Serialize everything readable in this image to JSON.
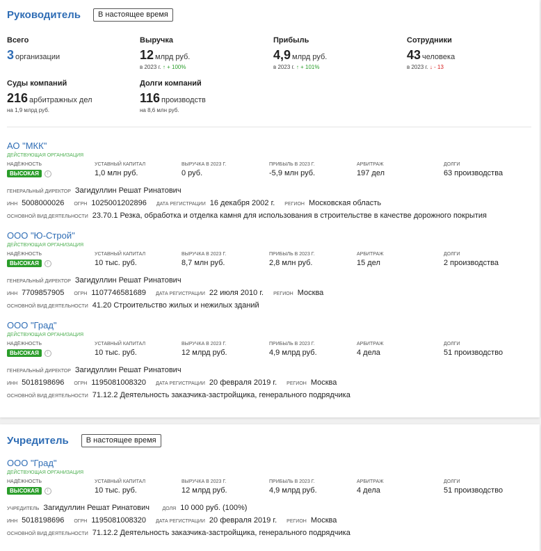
{
  "director_section": {
    "title": "Руководитель",
    "period": "В настоящее время",
    "stats": {
      "total": {
        "label": "Всего",
        "value": "3",
        "unit": "организации"
      },
      "revenue": {
        "label": "Выручка",
        "value": "12",
        "unit": "млрд руб.",
        "sub_prefix": "в 2023 г.",
        "sub_change": "↑ + 100%"
      },
      "profit": {
        "label": "Прибыль",
        "value": "4,9",
        "unit": "млрд руб.",
        "sub_prefix": "в 2023 г.",
        "sub_change": "↑ + 101%"
      },
      "employees": {
        "label": "Сотрудники",
        "value": "43",
        "unit": "человека",
        "sub_prefix": "в 2023 г.",
        "sub_change": "↓ - 13"
      },
      "courts": {
        "label": "Суды компаний",
        "value": "216",
        "unit": "арбитражных дел",
        "sub": "на 1,9 млрд руб."
      },
      "debts": {
        "label": "Долги компаний",
        "value": "116",
        "unit": "производств",
        "sub": "на 8,6 млн руб."
      }
    },
    "companies": [
      {
        "name": "АО \"МКК\"",
        "status": "действующая организация",
        "reliability_label": "надёжность",
        "reliability": "ВЫСОКАЯ",
        "capital_label": "уставный капитал",
        "capital": "1,0 млн руб.",
        "revenue_label": "выручка в 2023 г.",
        "revenue": "0 руб.",
        "profit_label": "прибыль в 2023 г.",
        "profit": "-5,9 млн руб.",
        "arbitration_label": "арбитраж",
        "arbitration": "197 дел",
        "debts_label": "долги",
        "debts": "63 производства",
        "role_label": "генеральный директор",
        "person": "Загидуллин Решат Ринатович",
        "inn_label": "инн",
        "inn": "5008000026",
        "ogrn_label": "огрн",
        "ogrn": "1025001202896",
        "reg_label": "дата регистрации",
        "reg_date": "16 декабря 2002 г.",
        "region_label": "регион",
        "region": "Московская область",
        "activity_label": "основной вид деятельности",
        "activity": "23.70.1 Резка, обработка и отделка камня для использования в строительстве в качестве дорожного покрытия"
      },
      {
        "name": "ООО \"Ю-Строй\"",
        "status": "действующая организация",
        "reliability_label": "надёжность",
        "reliability": "ВЫСОКАЯ",
        "capital_label": "уставный капитал",
        "capital": "10 тыс. руб.",
        "revenue_label": "выручка в 2023 г.",
        "revenue": "8,7 млн руб.",
        "profit_label": "прибыль в 2023 г.",
        "profit": "2,8 млн руб.",
        "arbitration_label": "арбитраж",
        "arbitration": "15 дел",
        "debts_label": "долги",
        "debts": "2 производства",
        "role_label": "генеральный директор",
        "person": "Загидуллин Решат Ринатович",
        "inn_label": "инн",
        "inn": "7709857905",
        "ogrn_label": "огрн",
        "ogrn": "1107746581689",
        "reg_label": "дата регистрации",
        "reg_date": "22 июля 2010 г.",
        "region_label": "регион",
        "region": "Москва",
        "activity_label": "основной вид деятельности",
        "activity": "41.20 Строительство жилых и нежилых зданий"
      },
      {
        "name": "ООО \"Град\"",
        "status": "действующая организация",
        "reliability_label": "надёжность",
        "reliability": "ВЫСОКАЯ",
        "capital_label": "уставный капитал",
        "capital": "10 тыс. руб.",
        "revenue_label": "выручка в 2023 г.",
        "revenue": "12 млрд руб.",
        "profit_label": "прибыль в 2023 г.",
        "profit": "4,9 млрд руб.",
        "arbitration_label": "арбитраж",
        "arbitration": "4 дела",
        "debts_label": "долги",
        "debts": "51 производство",
        "role_label": "генеральный директор",
        "person": "Загидуллин Решат Ринатович",
        "inn_label": "инн",
        "inn": "5018198696",
        "ogrn_label": "огрн",
        "ogrn": "1195081008320",
        "reg_label": "дата регистрации",
        "reg_date": "20 февраля 2019 г.",
        "region_label": "регион",
        "region": "Москва",
        "activity_label": "основной вид деятельности",
        "activity": "71.12.2 Деятельность заказчика-застройщика, генерального подрядчика"
      }
    ]
  },
  "founder_section": {
    "title": "Учредитель",
    "period": "В настоящее время",
    "company": {
      "name": "ООО \"Град\"",
      "status": "действующая организация",
      "reliability_label": "надёжность",
      "reliability": "ВЫСОКАЯ",
      "capital_label": "уставный капитал",
      "capital": "10 тыс. руб.",
      "revenue_label": "выручка в 2023 г.",
      "revenue": "12 млрд руб.",
      "profit_label": "прибыль в 2023 г.",
      "profit": "4,9 млрд руб.",
      "arbitration_label": "арбитраж",
      "arbitration": "4 дела",
      "debts_label": "долги",
      "debts": "51 производство",
      "role_label": "учредитель",
      "person": "Загидуллин Решат Ринатович",
      "share_label": "доля",
      "share": "10 000 руб. (100%)",
      "inn_label": "инн",
      "inn": "5018198696",
      "ogrn_label": "огрн",
      "ogrn": "1195081008320",
      "reg_label": "дата регистрации",
      "reg_date": "20 февраля 2019 г.",
      "region_label": "регион",
      "region": "Москва",
      "activity_label": "основной вид деятельности",
      "activity": "71.12.2 Деятельность заказчика-застройщика, генерального подрядчика"
    }
  }
}
